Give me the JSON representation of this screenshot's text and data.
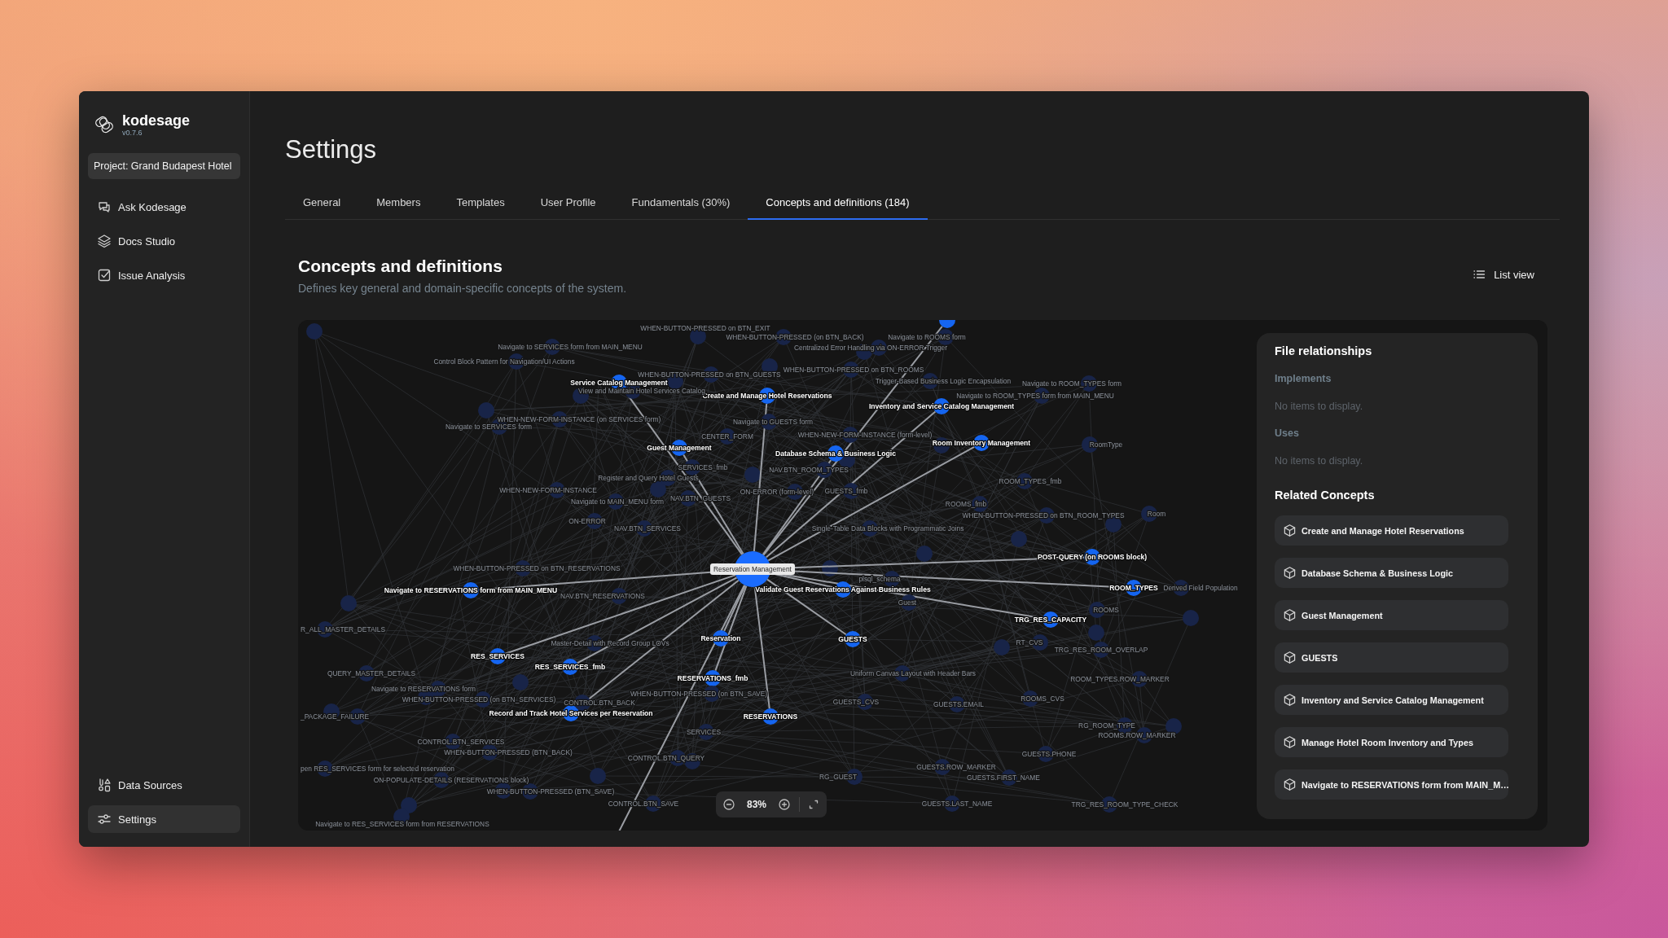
{
  "app": {
    "name": "kodesage",
    "version": "v0.7.6",
    "project": "Project: Grand Budapest Hotel"
  },
  "sidebar": {
    "items": [
      {
        "label": "Ask Kodesage",
        "kind": "chat",
        "selected": false
      },
      {
        "label": "Docs Studio",
        "kind": "layers",
        "selected": false
      },
      {
        "label": "Issue Analysis",
        "kind": "check",
        "selected": false
      }
    ],
    "bottom_items": [
      {
        "label": "Data Sources",
        "kind": "sources",
        "selected": false
      },
      {
        "label": "Settings",
        "kind": "sliders",
        "selected": true
      }
    ]
  },
  "page": {
    "title": "Settings"
  },
  "tabs": [
    {
      "label": "General",
      "selected": false
    },
    {
      "label": "Members",
      "selected": false
    },
    {
      "label": "Templates",
      "selected": false
    },
    {
      "label": "User Profile",
      "selected": false
    },
    {
      "label": "Fundamentals (30%)",
      "selected": false
    },
    {
      "label": "Concepts and definitions (184)",
      "selected": true
    }
  ],
  "section": {
    "title": "Concepts and definitions",
    "subtitle": "Defines key general and domain-specific concepts of the system.",
    "view_toggle": "List view"
  },
  "graph": {
    "center": "Reservation Management",
    "zoom": "83%",
    "nodes": [
      {
        "label": "Service Catalog Management",
        "linked": true
      },
      {
        "label": "Create and Manage Hotel Reservations",
        "linked": true
      },
      {
        "label": "Inventory and Service Catalog Management",
        "linked": true
      },
      {
        "label": "Room Inventory Management",
        "linked": true
      },
      {
        "label": "Guest Management",
        "linked": true
      },
      {
        "label": "Database Schema & Business Logic",
        "linked": true
      },
      {
        "label": "POST-QUERY (on ROOMS block)",
        "linked": true
      },
      {
        "label": "Navigate to RESERVATIONS form from MAIN_MENU",
        "linked": true
      },
      {
        "label": "Validate Guest Reservations Against Business Rules",
        "linked": true
      },
      {
        "label": "ROOM_TYPES",
        "linked": true
      },
      {
        "label": "TRG_RES_CAPACITY",
        "linked": true
      },
      {
        "label": "Reservation",
        "linked": true
      },
      {
        "label": "GUESTS",
        "linked": true
      },
      {
        "label": "RES_SERVICES",
        "linked": true
      },
      {
        "label": "RES_SERVICES_fmb",
        "linked": true
      },
      {
        "label": "RESERVATIONS_fmb",
        "linked": true
      },
      {
        "label": "Record and Track Hotel Services per Reservation",
        "linked": true
      },
      {
        "label": "RESERVATIONS",
        "linked": true
      },
      {
        "label": "WHEN-BUTTON-PRESSED on BTN_EXIT",
        "linked": false
      },
      {
        "label": "Navigate to SERVICES form from MAIN_MENU",
        "linked": false
      },
      {
        "label": "Control Block Pattern for Navigation/UI Actions",
        "linked": false
      },
      {
        "label": "WHEN-BUTTON-PRESSED on BTN_GUESTS",
        "linked": false
      },
      {
        "label": "View and Maintain Hotel Services Catalog",
        "linked": false
      },
      {
        "label": "WHEN-NEW-FORM-INSTANCE (on SERVICES form)",
        "linked": false
      },
      {
        "label": "Navigate to SERVICES form",
        "linked": false
      },
      {
        "label": "CENTER_FORM",
        "linked": false
      },
      {
        "label": "SERVICES_fmb",
        "linked": false
      },
      {
        "label": "Register and Query Hotel Guests",
        "linked": false
      },
      {
        "label": "WHEN-NEW-FORM-INSTANCE",
        "linked": false
      },
      {
        "label": "Navigate to MAIN_MENU form",
        "linked": false
      },
      {
        "label": "NAV.BTN_GUESTS",
        "linked": false
      },
      {
        "label": "ON-ERROR (form-level)",
        "linked": false
      },
      {
        "label": "ON-ERROR",
        "linked": false
      },
      {
        "label": "NAV.BTN_SERVICES",
        "linked": false
      },
      {
        "label": "WHEN-BUTTON-PRESSED on BTN_RESERVATIONS",
        "linked": false
      },
      {
        "label": "NAV.BTN_RESERVATIONS",
        "linked": false
      },
      {
        "label": "R_ALL_MASTER_DETAILS",
        "linked": false
      },
      {
        "label": "QUERY_MASTER_DETAILS",
        "linked": false
      },
      {
        "label": "Master-Detail with Record Group LOVs",
        "linked": false
      },
      {
        "label": "Navigate to RESERVATIONS form",
        "linked": false
      },
      {
        "label": "WHEN-BUTTON-PRESSED (on BTN_SERVICES)",
        "linked": false
      },
      {
        "label": "_PACKAGE_FAILURE",
        "linked": false
      },
      {
        "label": "CONTROL.BTN_BACK",
        "linked": false
      },
      {
        "label": "WHEN-BUTTON-PRESSED (on BTN_SAVE)",
        "linked": false
      },
      {
        "label": "SERVICES",
        "linked": false
      },
      {
        "label": "CONTROL.BTN_SERVICES",
        "linked": false
      },
      {
        "label": "WHEN-BUTTON-PRESSED (BTN_BACK)",
        "linked": false
      },
      {
        "label": "CONTROL.BTN_QUERY",
        "linked": false
      },
      {
        "label": "pen RES_SERVICES form for selected reservation",
        "linked": false
      },
      {
        "label": "ON-POPULATE-DETAILS (RESERVATIONS block)",
        "linked": false
      },
      {
        "label": "WHEN-BUTTON-PRESSED (BTN_SAVE)",
        "linked": false
      },
      {
        "label": "CONTROL.BTN_SAVE",
        "linked": false
      },
      {
        "label": "Navigate to RES_SERVICES form from RESERVATIONS",
        "linked": false
      },
      {
        "label": "WHEN-BUTTON-PRESSED (on BTN_BACK)",
        "linked": false
      },
      {
        "label": "Navigate to ROOMS form",
        "linked": false
      },
      {
        "label": "Centralized Error Handling via ON-ERROR Trigger",
        "linked": false
      },
      {
        "label": "WHEN-BUTTON-PRESSED on BTN_ROOMS",
        "linked": false
      },
      {
        "label": "Trigger-Based Business Logic Encapsulation",
        "linked": false
      },
      {
        "label": "Navigate to ROOM_TYPES form",
        "linked": false
      },
      {
        "label": "Navigate to ROOM_TYPES form from MAIN_MENU",
        "linked": false
      },
      {
        "label": "Navigate to GUESTS form",
        "linked": false
      },
      {
        "label": "WHEN-NEW-FORM-INSTANCE (form-level)",
        "linked": false
      },
      {
        "label": "NAV.BTN_ROOM_TYPES",
        "linked": false
      },
      {
        "label": "GUESTS_fmb",
        "linked": false
      },
      {
        "label": "ROOM_TYPES_fmb",
        "linked": false
      },
      {
        "label": "RoomType",
        "linked": false
      },
      {
        "label": "ROOMS_fmb",
        "linked": false
      },
      {
        "label": "WHEN-BUTTON-PRESSED on BTN_ROOM_TYPES",
        "linked": false
      },
      {
        "label": "Room",
        "linked": false
      },
      {
        "label": "Single-Table Data Blocks with Programmatic Joins",
        "linked": false
      },
      {
        "label": "plsql_schema",
        "linked": false
      },
      {
        "label": "Guest",
        "linked": false
      },
      {
        "label": "ROOMS",
        "linked": false
      },
      {
        "label": "Derived Field Population",
        "linked": false
      },
      {
        "label": "RT_CVS",
        "linked": false
      },
      {
        "label": "TRG_RES_ROOM_OVERLAP",
        "linked": false
      },
      {
        "label": "Uniform Canvas Layout with Header Bars",
        "linked": false
      },
      {
        "label": "ROOM_TYPES.ROW_MARKER",
        "linked": false
      },
      {
        "label": "GUESTS_CVS",
        "linked": false
      },
      {
        "label": "GUESTS.EMAIL",
        "linked": false
      },
      {
        "label": "ROOMS_CVS",
        "linked": false
      },
      {
        "label": "RG_ROOM_TYPE",
        "linked": false
      },
      {
        "label": "ROOMS.ROW_MARKER",
        "linked": false
      },
      {
        "label": "GUESTS.PHONE",
        "linked": false
      },
      {
        "label": "GUESTS.ROW_MARKER",
        "linked": false
      },
      {
        "label": "RG_GUEST",
        "linked": false
      },
      {
        "label": "GUESTS.FIRST_NAME",
        "linked": false
      },
      {
        "label": "GUESTS.LAST_NAME",
        "linked": false
      },
      {
        "label": "TRG_RES_ROOM_TYPE_CHECK",
        "linked": false
      }
    ]
  },
  "panel": {
    "title": "File relationships",
    "sections": [
      {
        "title": "Implements",
        "empty": "No items to display."
      },
      {
        "title": "Uses",
        "empty": "No items to display."
      }
    ],
    "related_title": "Related Concepts",
    "related": [
      "Create and Manage Hotel Reservations",
      "Database Schema & Business Logic",
      "Guest Management",
      "GUESTS",
      "Inventory and Service Catalog Management",
      "Manage Hotel Room Inventory and Types",
      "Navigate to RESERVATIONS form from MAIN_M…"
    ]
  }
}
